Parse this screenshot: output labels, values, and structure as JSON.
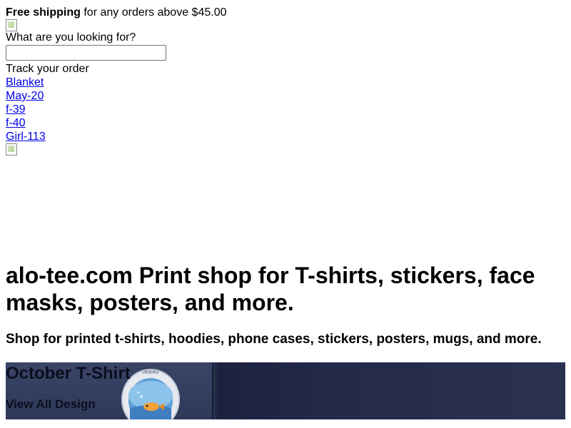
{
  "announcement": {
    "bold": "Free shipping",
    "rest": " for any orders above $45.00"
  },
  "search": {
    "label": "What are you looking for?",
    "value": ""
  },
  "track_order": "Track your order",
  "menu": {
    "items": [
      {
        "label": "Blanket"
      },
      {
        "label": "May-20"
      },
      {
        "label": "f-39"
      },
      {
        "label": "f-40"
      },
      {
        "label": "Girl-113"
      }
    ]
  },
  "hero": {
    "title": "alo-tee.com Print shop for T-shirts, stickers, face masks, posters, and more.",
    "subtitle": "Shop for printed t-shirts, hoodies, phone cases, stickers, posters, mugs, and more."
  },
  "banner": {
    "title": "October T-Shirt",
    "link_label": "View All Design"
  },
  "icons": {
    "logo": "broken-image-icon",
    "hero_image": "broken-image-icon"
  }
}
